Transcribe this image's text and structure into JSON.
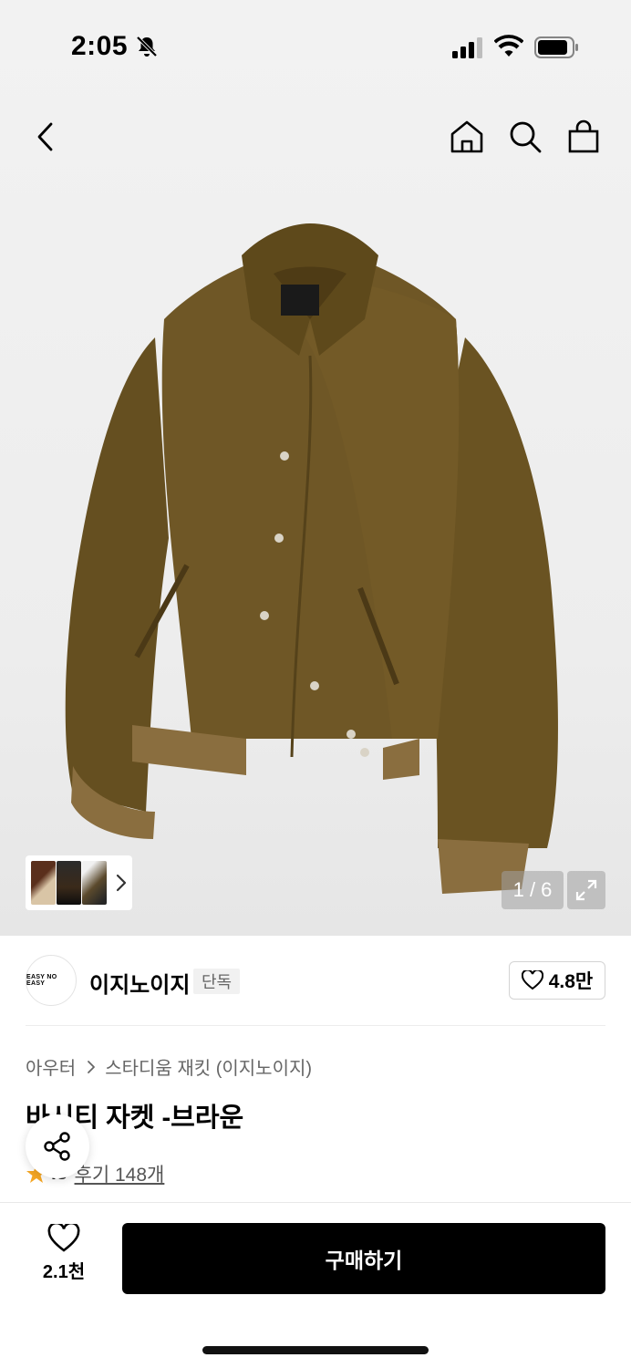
{
  "status_bar": {
    "time": "2:05"
  },
  "icons": {
    "back": "chevron-left-icon",
    "home": "home-icon",
    "search": "search-icon",
    "cart": "shopping-bag-icon",
    "expand": "expand-icon",
    "share": "share-icon",
    "wish": "heart-icon",
    "star": "star-icon"
  },
  "gallery": {
    "counter": "1 / 6"
  },
  "brand": {
    "logo_text": "EASY NO EASY",
    "name": "이지노이지",
    "badge": "단독",
    "like_count": "4.8만"
  },
  "breadcrumb": {
    "category": "아우터",
    "subcategory": "스타디움 재킷 (이지노이지)"
  },
  "product": {
    "title": "바시티 자켓 -브라운",
    "rating": ".8",
    "review_link": "후기 148개"
  },
  "bottom_bar": {
    "wish_count": "2.1천",
    "buy_label": "구매하기"
  },
  "colors": {
    "accent_star": "#f5a623",
    "buy_button": "#000000",
    "jacket": "#6b5422"
  }
}
